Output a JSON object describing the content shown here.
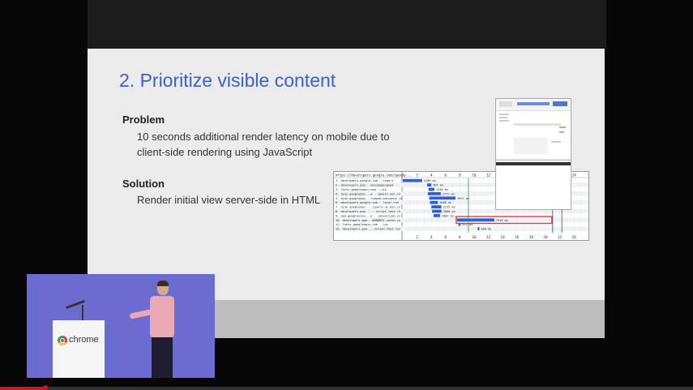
{
  "slide": {
    "title": "2. Prioritize visible content",
    "problem_label": "Problem",
    "problem_line1": "10 seconds additional render latency on mobile due to",
    "problem_line2": "client-side rendering using JavaScript",
    "solution_label": "Solution",
    "solution_line1": "Render initial view server-side in HTML"
  },
  "waterfall": {
    "url": "https://developers.google.com/speedy...",
    "ticks_top": [
      "2",
      "4",
      "6",
      "8",
      "10",
      "12",
      "24"
    ],
    "ticks_bottom": [
      "2",
      "4",
      "6",
      "8",
      "10",
      "12",
      "14",
      "16",
      "18",
      "20",
      "22",
      "24"
    ],
    "rows": [
      {
        "label": "1. developers.google.com - report",
        "timing": "4108 ms"
      },
      {
        "label": "2. developers.goo...ses/pagespeed",
        "timing": "907 ms"
      },
      {
        "label": "3. fonts.googleapis.com - css",
        "timing": "1246 ms"
      },
      {
        "label": "4. ajax.googleapi...a - jquery.min.js",
        "timing": "2772 ms"
      },
      {
        "label": "5. ajax.googleapi...rsawed.mascache.js",
        "timing": "5597 ms"
      },
      {
        "label": "6. developers.google.com - local.css",
        "timing": "1668 ms"
      },
      {
        "label": "7. ajax.googleapi... jquery-ui.min.js",
        "timing": "2135 ms"
      },
      {
        "label": "8. developers.goo... - script_foot.js",
        "timing": "2000 ms"
      },
      {
        "label": "9. www.googleusee...a - conversion.js",
        "timing": "1404 ms"
      },
      {
        "label": "10. developers.goo...WORDREI.cache.js",
        "timing": "7919 ms"
      },
      {
        "label": "11. fonts.googleapis.com - css",
        "timing": "453 ms"
      },
      {
        "label": "12. developers.goo... screen-foot.css",
        "timing": "306 ms"
      }
    ]
  },
  "player": {
    "video_label": "chrome",
    "progress_fraction": 0.065
  },
  "colors": {
    "title": "#3a5fcf",
    "bar": "#2f5fd6",
    "highlight": "#e53935",
    "progress": "#cc181e"
  }
}
